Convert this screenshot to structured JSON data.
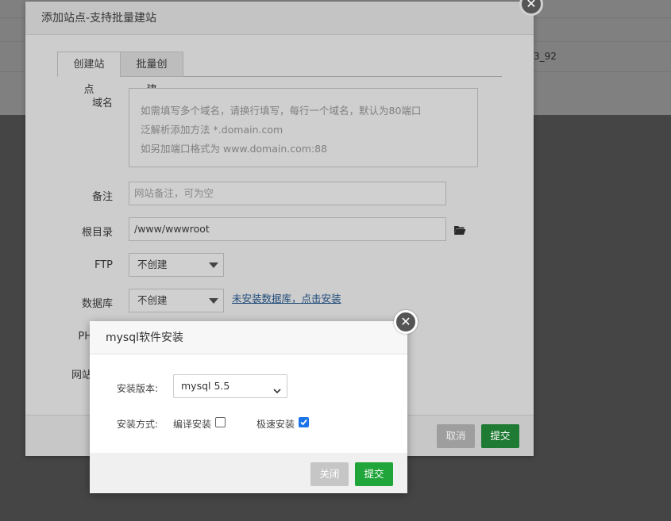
{
  "background": {
    "row_text": "3_92"
  },
  "main_dialog": {
    "title": "添加站点-支持批量建站",
    "close_glyph": "✕",
    "tabs": [
      {
        "label": "创建站点"
      },
      {
        "label": "批量创建"
      }
    ],
    "domain": {
      "label": "域名",
      "placeholder_lines": [
        "如需填写多个域名，请换行填写，每行一个域名，默认为80端口",
        "泛解析添加方法 *.domain.com",
        "如另加端口格式为 www.domain.com:88"
      ]
    },
    "remark": {
      "label": "备注",
      "placeholder": "网站备注，可为空"
    },
    "root_dir": {
      "label": "根目录",
      "value": "/www/wwwroot"
    },
    "ftp": {
      "label": "FTP",
      "selected": "不创建"
    },
    "database": {
      "label": "数据库",
      "selected": "不创建",
      "link_text": "未安装数据库，点击安装"
    },
    "php_label_partial": "PH",
    "site_label_partial": "网站",
    "cancel_label": "取消",
    "submit_label": "提交"
  },
  "mysql_dialog": {
    "title": "mysql软件安装",
    "close_glyph": "✕",
    "version_label": "安装版本:",
    "version_selected": "mysql 5.5",
    "method_label": "安装方式:",
    "compile_label": "编译安装",
    "compile_checked": false,
    "fast_label": "极速安装",
    "fast_checked": true,
    "close_label": "关闭",
    "submit_label": "提交"
  },
  "colors": {
    "submit_green": "#20a53a",
    "checkbox_blue": "#1a73e8",
    "link_blue": "#1f4b7a"
  }
}
